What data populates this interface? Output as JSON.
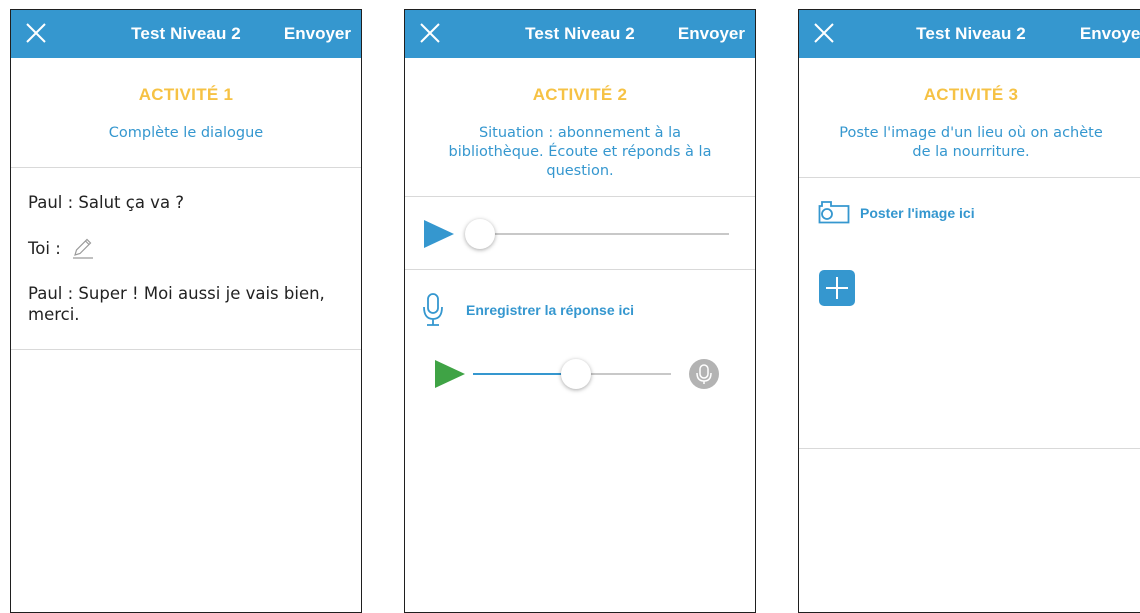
{
  "header": {
    "title": "Test Niveau 2",
    "send_label": "Envoyer"
  },
  "activity1": {
    "title": "ACTIVITÉ 1",
    "instruction": "Complète le dialogue",
    "dialogue": {
      "line1": "Paul : Salut ça va ?",
      "line2_speaker": "Toi :",
      "line3": "Paul : Super ! Moi aussi je vais bien, merci."
    }
  },
  "activity2": {
    "title": "ACTIVITÉ 2",
    "instruction": "Situation : abonnement à la bibliothèque. Écoute et réponds à la question.",
    "audio_progress": 0.0,
    "record_label": "Enregistrer la réponse ici",
    "recording_progress": 0.39
  },
  "activity3": {
    "title": "ACTIVITÉ 3",
    "instruction": "Poste l'image d'un lieu où on achète de la nourriture.",
    "post_label": "Poster l'image ici"
  },
  "icons": {
    "close": "close-icon",
    "pencil": "pencil-icon",
    "play_audio": "play-icon",
    "play_recording": "play-icon",
    "microphone": "microphone-icon",
    "camera": "camera-icon",
    "plus": "plus-icon"
  },
  "colors": {
    "header_bg": "#3597cf",
    "activity_title": "#f6c244",
    "instruction": "#3597cf",
    "play_audio": "#3597cf",
    "play_recording": "#3fa345",
    "record_mic_button": "#b3b3b3"
  }
}
